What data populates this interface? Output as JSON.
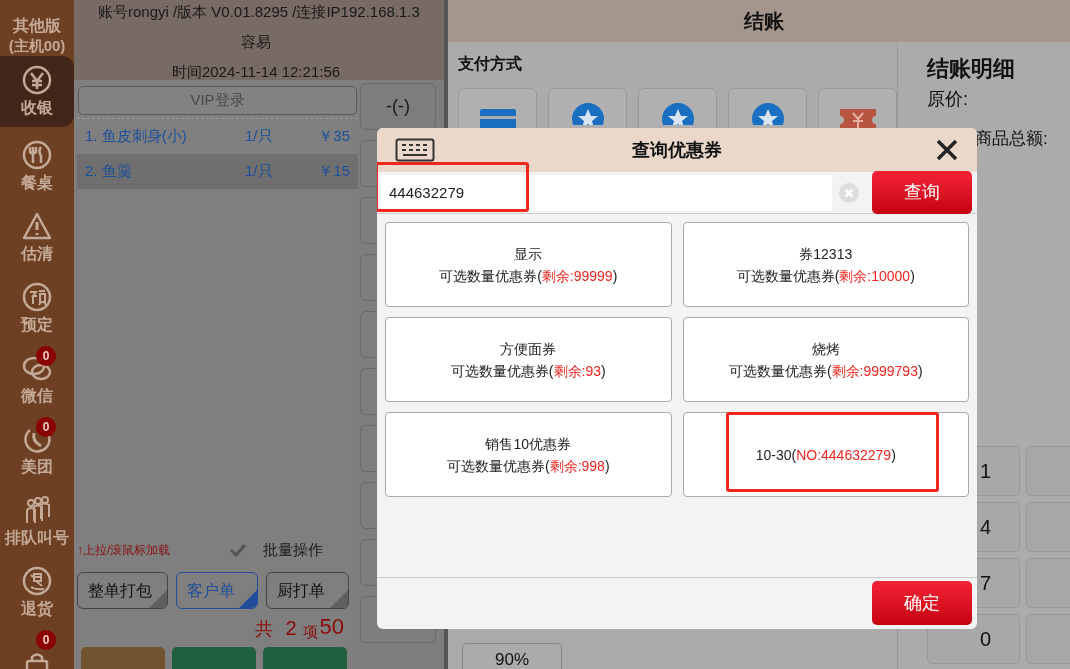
{
  "sidebar": {
    "title": "其他版",
    "subtitle": "(主机00)",
    "items": [
      {
        "label": "收银",
        "selected": true
      },
      {
        "label": "餐桌",
        "selected": false
      },
      {
        "label": "估清",
        "selected": false
      },
      {
        "label": "预定",
        "selected": false
      },
      {
        "label": "微信",
        "badge": "0",
        "selected": false
      },
      {
        "label": "美团",
        "badge": "0",
        "selected": false
      },
      {
        "label": "排队叫号",
        "selected": false
      },
      {
        "label": "退货",
        "selected": false
      },
      {
        "badge": "0",
        "selected": false
      }
    ]
  },
  "header": {
    "account": "账号rongyi /版本 V0.01.8295 /连接IP192.168.1.3",
    "user": "容易",
    "time": "时间2024-11-14 12:21:56"
  },
  "order": {
    "vip_button": "VIP登录",
    "rows": [
      {
        "name": "1. 鱼皮刺身(小)",
        "qty": "1/只",
        "price": "￥35",
        "selected": false
      },
      {
        "name": "2. 鱼羹",
        "qty": "1/只",
        "price": "￥15",
        "selected": true
      }
    ],
    "load_hint": "↑上拉/滚鼠标加载",
    "batch_label": "批量操作",
    "print_buttons": [
      {
        "label": "整单打包",
        "selected": false
      },
      {
        "label": "客户单",
        "selected": true
      },
      {
        "label": "厨打单",
        "selected": false
      }
    ],
    "total": {
      "prefix": "共",
      "count": "2",
      "unit": "项",
      "amount": "50"
    }
  },
  "side_buttons": [
    "-(-)"
  ],
  "checkout": {
    "title": "结账",
    "payment_label": "支付方式",
    "discount_button": "90%",
    "detail_title": "结账明细",
    "original_label": "原价:",
    "total_label": "商品总额:",
    "keys": [
      "1",
      "4",
      "7",
      "0"
    ]
  },
  "dialog": {
    "title": "查询优惠券",
    "search": {
      "value": "444632279",
      "highlighted": true
    },
    "search_button": "查询",
    "coupons": [
      {
        "name": "显示",
        "prefix": "可选数量优惠券(",
        "remaining": "剩余:99999",
        "suffix": ")",
        "highlighted": false
      },
      {
        "name": "券12313",
        "prefix": "可选数量优惠券(",
        "remaining": "剩余:10000",
        "suffix": ")",
        "highlighted": false
      },
      {
        "name": "方便面券",
        "prefix": "可选数量优惠券(",
        "remaining": "剩余:93",
        "suffix": ")",
        "highlighted": false
      },
      {
        "name": "烧烤",
        "prefix": "可选数量优惠券(",
        "remaining": "剩余:9999793",
        "suffix": ")",
        "highlighted": false
      },
      {
        "name": "销售10优惠券",
        "prefix": "可选数量优惠券(",
        "remaining": "剩余:998",
        "suffix": ")",
        "highlighted": false
      },
      {
        "prefix": "10-30(",
        "remaining": "NO:444632279",
        "suffix": ")",
        "highlighted": true
      }
    ],
    "confirm_button": "确定"
  }
}
